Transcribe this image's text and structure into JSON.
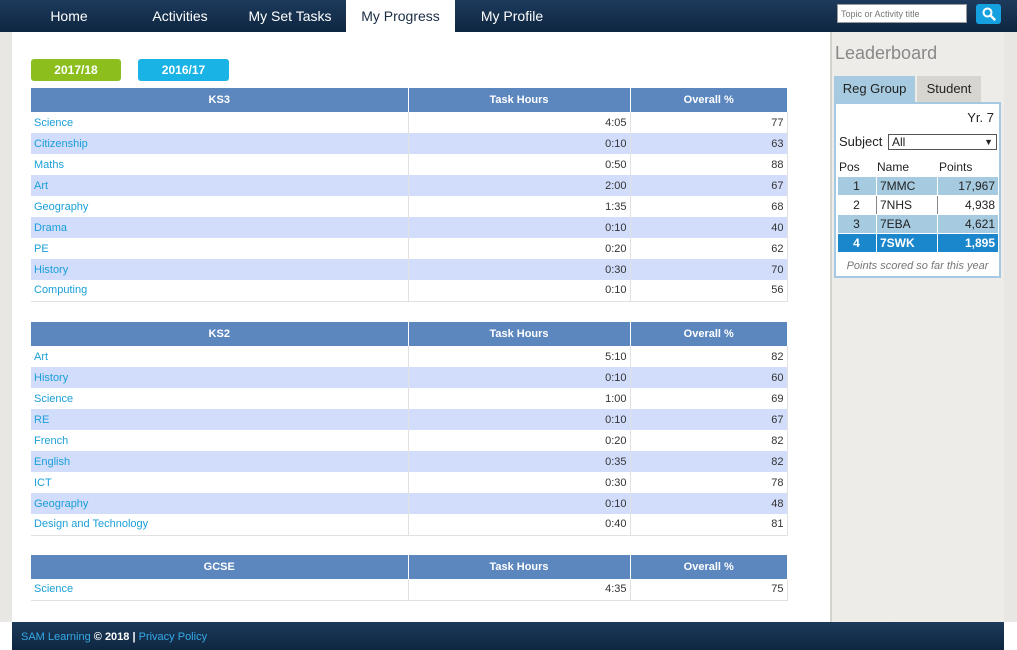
{
  "nav": {
    "items": [
      {
        "label": "Home"
      },
      {
        "label": "Activities"
      },
      {
        "label": "My Set Tasks"
      },
      {
        "label": "My Progress"
      },
      {
        "label": "My Profile"
      }
    ],
    "search_placeholder": "Topic or Activity title"
  },
  "years": {
    "current": "2017/18",
    "previous": "2016/17",
    "current_color": "#8cbf1e",
    "previous_color": "#19b3e6"
  },
  "tables": {
    "ks3": {
      "headers": [
        "KS3",
        "Task Hours",
        "Overall %"
      ],
      "rows": [
        [
          "Science",
          "4:05",
          "77"
        ],
        [
          "Citizenship",
          "0:10",
          "63"
        ],
        [
          "Maths",
          "0:50",
          "88"
        ],
        [
          "Art",
          "2:00",
          "67"
        ],
        [
          "Geography",
          "1:35",
          "68"
        ],
        [
          "Drama",
          "0:10",
          "40"
        ],
        [
          "PE",
          "0:20",
          "62"
        ],
        [
          "History",
          "0:30",
          "70"
        ],
        [
          "Computing",
          "0:10",
          "56"
        ]
      ]
    },
    "ks2": {
      "headers": [
        "KS2",
        "Task Hours",
        "Overall %"
      ],
      "rows": [
        [
          "Art",
          "5:10",
          "82"
        ],
        [
          "History",
          "0:10",
          "60"
        ],
        [
          "Science",
          "1:00",
          "69"
        ],
        [
          "RE",
          "0:10",
          "67"
        ],
        [
          "French",
          "0:20",
          "82"
        ],
        [
          "English",
          "0:35",
          "82"
        ],
        [
          "ICT",
          "0:30",
          "78"
        ],
        [
          "Geography",
          "0:10",
          "48"
        ],
        [
          "Design and Technology",
          "0:40",
          "81"
        ]
      ]
    },
    "gcse": {
      "headers": [
        "GCSE",
        "Task Hours",
        "Overall %"
      ],
      "rows": [
        [
          "Science",
          "4:35",
          "75"
        ]
      ]
    }
  },
  "leaderboard": {
    "title": "Leaderboard",
    "tabs": [
      "Reg Group",
      "Student"
    ],
    "year": "Yr. 7",
    "subject_label": "Subject",
    "subject_value": "All",
    "headers": [
      "Pos",
      "Name",
      "Points"
    ],
    "rows": [
      {
        "pos": "1",
        "name": "7MMC",
        "points": "17,967"
      },
      {
        "pos": "2",
        "name": "7NHS",
        "points": "4,938"
      },
      {
        "pos": "3",
        "name": "7EBA",
        "points": "4,621"
      },
      {
        "pos": "4",
        "name": "7SWK",
        "points": "1,895"
      }
    ],
    "note": "Points scored so far this year"
  },
  "footer": {
    "brand": "SAM Learning",
    "copyright": "© 2018 |",
    "privacy": "Privacy Policy"
  }
}
